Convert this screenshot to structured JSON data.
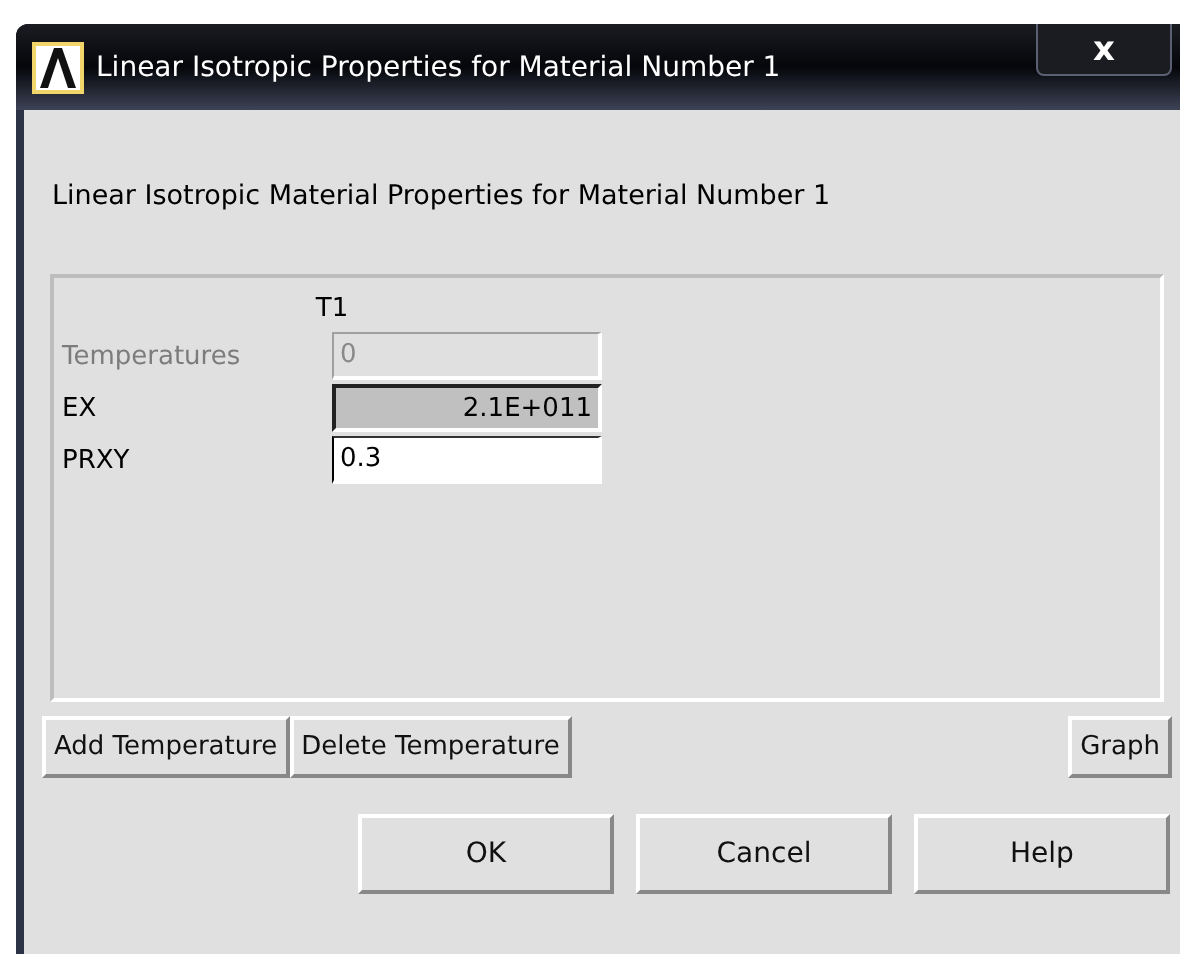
{
  "window": {
    "title": "Linear Isotropic Properties for Material Number 1",
    "close": "x"
  },
  "heading": "Linear Isotropic Material Properties for Material Number 1",
  "table": {
    "column": "T1",
    "rows": [
      {
        "label": "Temperatures",
        "value": "0",
        "disabled": true,
        "selected": false
      },
      {
        "label": "EX",
        "value": "2.1E+011",
        "disabled": false,
        "selected": true
      },
      {
        "label": "PRXY",
        "value": "0.3",
        "disabled": false,
        "selected": false
      }
    ]
  },
  "tool_buttons": [
    "Add Temperature",
    "Delete Temperature"
  ],
  "graph_button": "Graph",
  "buttons": [
    "OK",
    "Cancel",
    "Help"
  ]
}
